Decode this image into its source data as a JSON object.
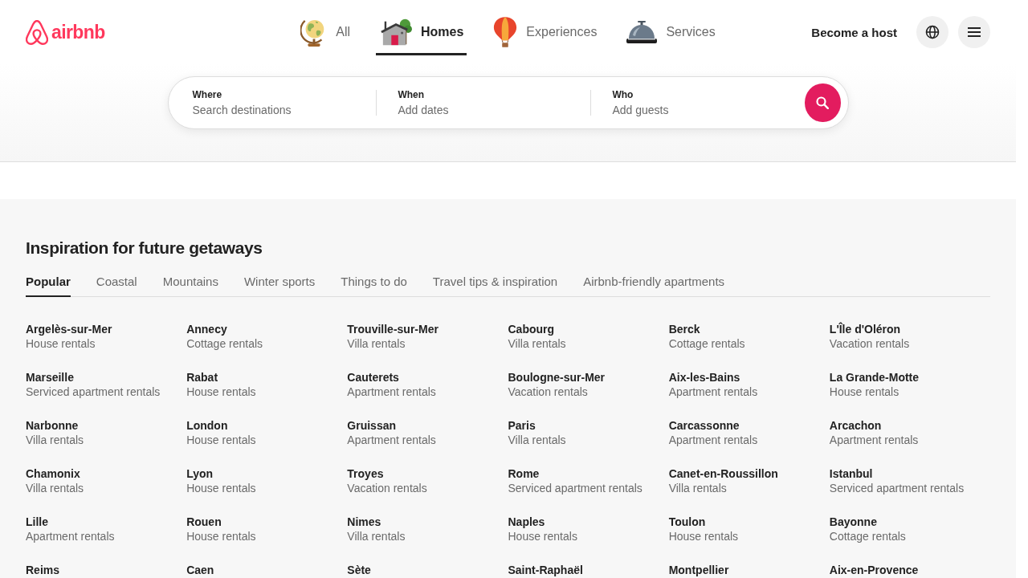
{
  "header": {
    "logo_text": "airbnb",
    "categories": [
      {
        "label": "All",
        "selected": false
      },
      {
        "label": "Homes",
        "selected": true
      },
      {
        "label": "Experiences",
        "selected": false
      },
      {
        "label": "Services",
        "selected": false
      }
    ],
    "host_link": "Become a host"
  },
  "search": {
    "fields": [
      {
        "label": "Where",
        "placeholder": "Search destinations"
      },
      {
        "label": "When",
        "placeholder": "Add dates"
      },
      {
        "label": "Who",
        "placeholder": "Add guests"
      }
    ]
  },
  "inspiration": {
    "title": "Inspiration for future getaways",
    "tabs": [
      {
        "label": "Popular",
        "selected": true
      },
      {
        "label": "Coastal",
        "selected": false
      },
      {
        "label": "Mountains",
        "selected": false
      },
      {
        "label": "Winter sports",
        "selected": false
      },
      {
        "label": "Things to do",
        "selected": false
      },
      {
        "label": "Travel tips & inspiration",
        "selected": false
      },
      {
        "label": "Airbnb-friendly apartments",
        "selected": false
      }
    ],
    "destinations": [
      {
        "name": "Argelès-sur-Mer",
        "type": "House rentals"
      },
      {
        "name": "Annecy",
        "type": "Cottage rentals"
      },
      {
        "name": "Trouville-sur-Mer",
        "type": "Villa rentals"
      },
      {
        "name": "Cabourg",
        "type": "Villa rentals"
      },
      {
        "name": "Berck",
        "type": "Cottage rentals"
      },
      {
        "name": "L'Île d'Oléron",
        "type": "Vacation rentals"
      },
      {
        "name": "Marseille",
        "type": "Serviced apartment rentals"
      },
      {
        "name": "Rabat",
        "type": "House rentals"
      },
      {
        "name": "Cauterets",
        "type": "Apartment rentals"
      },
      {
        "name": "Boulogne-sur-Mer",
        "type": "Vacation rentals"
      },
      {
        "name": "Aix-les-Bains",
        "type": "Apartment rentals"
      },
      {
        "name": "La Grande-Motte",
        "type": "House rentals"
      },
      {
        "name": "Narbonne",
        "type": "Villa rentals"
      },
      {
        "name": "London",
        "type": "House rentals"
      },
      {
        "name": "Gruissan",
        "type": "Apartment rentals"
      },
      {
        "name": "Paris",
        "type": "Villa rentals"
      },
      {
        "name": "Carcassonne",
        "type": "Apartment rentals"
      },
      {
        "name": "Arcachon",
        "type": "Apartment rentals"
      },
      {
        "name": "Chamonix",
        "type": "Villa rentals"
      },
      {
        "name": "Lyon",
        "type": "House rentals"
      },
      {
        "name": "Troyes",
        "type": "Vacation rentals"
      },
      {
        "name": "Rome",
        "type": "Serviced apartment rentals"
      },
      {
        "name": "Canet-en-Roussillon",
        "type": "Villa rentals"
      },
      {
        "name": "Istanbul",
        "type": "Serviced apartment rentals"
      },
      {
        "name": "Lille",
        "type": "Apartment rentals"
      },
      {
        "name": "Rouen",
        "type": "House rentals"
      },
      {
        "name": "Nimes",
        "type": "Villa rentals"
      },
      {
        "name": "Naples",
        "type": "House rentals"
      },
      {
        "name": "Toulon",
        "type": "House rentals"
      },
      {
        "name": "Bayonne",
        "type": "Cottage rentals"
      },
      {
        "name": "Reims"
      },
      {
        "name": "Caen"
      },
      {
        "name": "Sète"
      },
      {
        "name": "Saint-Raphaël"
      },
      {
        "name": "Montpellier"
      },
      {
        "name": "Aix-en-Provence"
      }
    ]
  }
}
